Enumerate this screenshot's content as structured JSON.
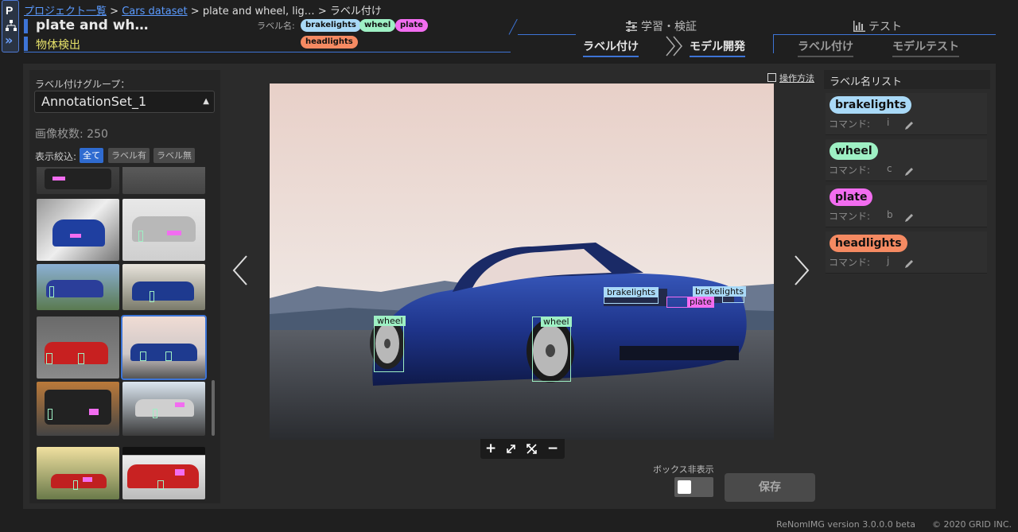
{
  "rail": {
    "logo": "P"
  },
  "breadcrumb": {
    "root": "プロジェクト一覧",
    "sep1": " > ",
    "dataset": "Cars dataset",
    "sep2": " > ",
    "project": "plate and wheel, lig…",
    "sep3": " > ",
    "page": "ラベル付け"
  },
  "project": {
    "title": "plate and wh…",
    "task": "物体検出"
  },
  "labels_header": {
    "title": "ラベル名:",
    "chips": [
      "brakelights",
      "wheel",
      "plate",
      "headlights"
    ]
  },
  "nav": {
    "train_section": "学習・検証",
    "test_section": "テスト",
    "tab_label": "ラベル付け",
    "tab_model": "モデル開発",
    "tab_test_label": "ラベル付け",
    "tab_model_test": "モデルテスト"
  },
  "left": {
    "group_label": "ラベル付けグループ：",
    "group_value": "AnnotationSet_1",
    "image_count": "画像枚数: 250",
    "filter_label": "表示絞込:",
    "filter_all": "全て",
    "filter_labeled": "ラベル有",
    "filter_unlabeled": "ラベル無"
  },
  "canvas": {
    "howto": "操作方法",
    "boxes": [
      "brakelights",
      "brakelights",
      "plate",
      "wheel",
      "wheel"
    ]
  },
  "controls": {
    "hide_boxes": "ボックス非表示",
    "save": "保存"
  },
  "label_list": {
    "title": "ラベル名リスト",
    "command_prefix": "コマンド:",
    "items": [
      {
        "name": "brakelights",
        "key": "i",
        "color": "#a9d9f7"
      },
      {
        "name": "wheel",
        "key": "c",
        "color": "#9ef0c4"
      },
      {
        "name": "plate",
        "key": "b",
        "color": "#f26df0"
      },
      {
        "name": "headlights",
        "key": "j",
        "color": "#f58a62"
      }
    ]
  },
  "footer": {
    "version": "ReNomIMG version 3.0.0.0 beta",
    "copyright": "© 2020 GRID INC."
  },
  "colors": {
    "accent": "#3d74d6",
    "brakelights": "#a9d9f7",
    "wheel": "#9ef0c4",
    "plate": "#f26df0",
    "headlights": "#f58a62"
  }
}
